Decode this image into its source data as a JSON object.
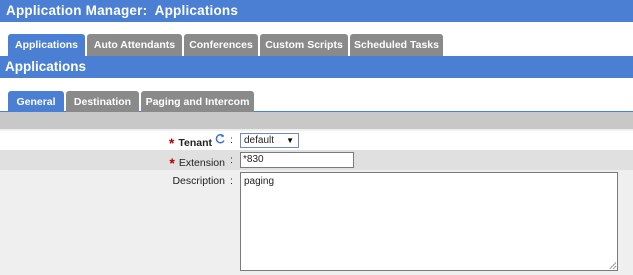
{
  "window": {
    "title": "Application Manager:  Applications"
  },
  "main_tabs": [
    {
      "label": "Applications",
      "active": true
    },
    {
      "label": "Auto Attendants",
      "active": false
    },
    {
      "label": "Conferences",
      "active": false
    },
    {
      "label": "Custom Scripts",
      "active": false
    },
    {
      "label": "Scheduled Tasks",
      "active": false
    }
  ],
  "section": {
    "title": "Applications"
  },
  "sub_tabs": [
    {
      "label": "General",
      "active": true
    },
    {
      "label": "Destination",
      "active": false
    },
    {
      "label": "Paging and Intercom",
      "active": false
    }
  ],
  "form": {
    "tenant": {
      "label": "Tenant",
      "value": "default",
      "required": true
    },
    "extension": {
      "label": "Extension",
      "value": "*830",
      "required": true
    },
    "description": {
      "label": "Description",
      "value": "paging"
    },
    "colon": ":",
    "required_marker": "*"
  },
  "icons": {
    "refresh": "refresh-icon",
    "dropdown": "chevron-down-icon"
  },
  "colors": {
    "accent": "#4a7fd4",
    "inactive_tab": "#8a8a8a",
    "required": "#b00000"
  }
}
